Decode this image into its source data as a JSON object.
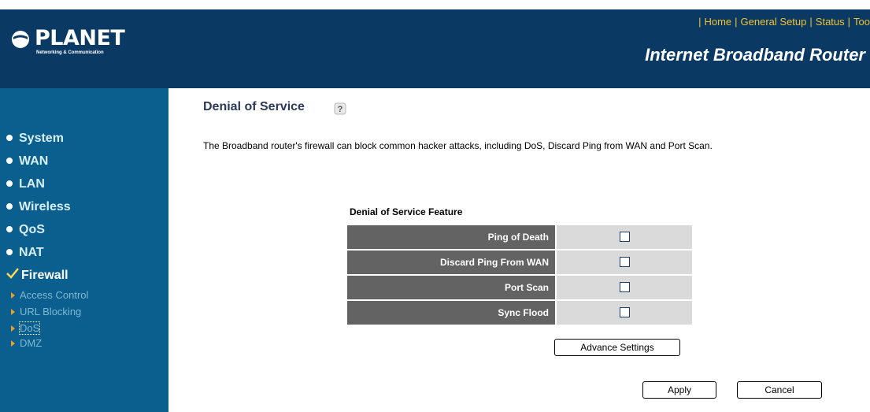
{
  "colors": {
    "header_bg": "#0a3a64",
    "sidebar_bg": "#0a5f8e",
    "nav_link": "#f2c230",
    "table_label_bg": "#636363",
    "table_cell_bg": "#dadada"
  },
  "header": {
    "brand": "PLANET",
    "tagline": "Networking & Communication",
    "product": "Internet Broadband Router",
    "nav": [
      {
        "label": "Home"
      },
      {
        "label": "General Setup"
      },
      {
        "label": "Status"
      },
      {
        "label": "Too"
      }
    ]
  },
  "sidebar": {
    "items": [
      {
        "label": "System",
        "icon": "bullet-icon"
      },
      {
        "label": "WAN",
        "icon": "bullet-icon"
      },
      {
        "label": "LAN",
        "icon": "bullet-icon"
      },
      {
        "label": "Wireless",
        "icon": "bullet-icon"
      },
      {
        "label": "QoS",
        "icon": "bullet-icon"
      },
      {
        "label": "NAT",
        "icon": "bullet-icon"
      },
      {
        "label": "Firewall",
        "icon": "checkmark-icon"
      }
    ],
    "sub_items": [
      {
        "label": "Access Control"
      },
      {
        "label": "URL Blocking"
      },
      {
        "label": "DoS"
      },
      {
        "label": "DMZ"
      }
    ]
  },
  "main": {
    "title": "Denial of Service",
    "description": "The Broadband router's firewall can block common hacker attacks, including DoS, Discard Ping from WAN and Port Scan.",
    "feature_heading": "Denial of Service Feature",
    "features": [
      {
        "label": "Ping of Death",
        "checked": false
      },
      {
        "label": "Discard Ping From WAN",
        "checked": false
      },
      {
        "label": "Port Scan",
        "checked": false
      },
      {
        "label": "Sync Flood",
        "checked": false
      }
    ],
    "advance_label": "Advance Settings",
    "apply_label": "Apply",
    "cancel_label": "Cancel"
  }
}
